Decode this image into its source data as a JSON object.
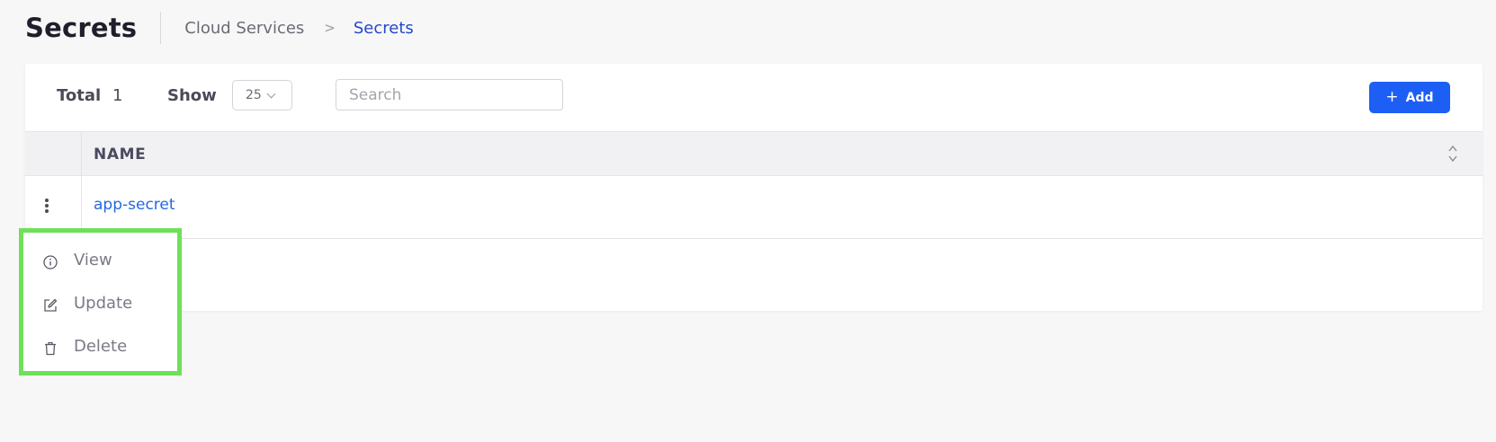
{
  "header": {
    "title": "Secrets",
    "breadcrumb": {
      "parent": "Cloud Services",
      "separator": ">",
      "current": "Secrets"
    }
  },
  "toolbar": {
    "total_label": "Total",
    "total_count": "1",
    "show_label": "Show",
    "page_size": "25",
    "search_placeholder": "Search",
    "search_value": "",
    "add_label": "Add",
    "add_icon": "plus-icon"
  },
  "table": {
    "columns": [
      {
        "label": "NAME",
        "sort_icon": "sort-icon"
      }
    ],
    "rows": [
      {
        "name": "app-secret",
        "actions_icon": "kebab-icon"
      }
    ]
  },
  "row_menu": {
    "items": [
      {
        "label": "View",
        "icon": "info-icon"
      },
      {
        "label": "Update",
        "icon": "edit-icon"
      },
      {
        "label": "Delete",
        "icon": "trash-icon"
      }
    ],
    "highlight_color": "#6ee05a"
  },
  "colors": {
    "accent": "#1d5ff5",
    "link": "#2468e0",
    "breadcrumb_current": "#2448c8",
    "background": "#f7f7f8"
  }
}
